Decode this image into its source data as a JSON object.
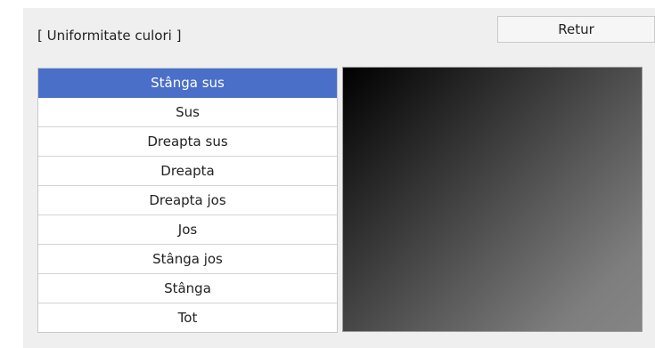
{
  "header": {
    "title": "[ Uniformitate culori ]",
    "return_label": "Retur"
  },
  "menu": {
    "selected_index": 0,
    "items": [
      {
        "label": "Stânga sus"
      },
      {
        "label": "Sus"
      },
      {
        "label": "Dreapta sus"
      },
      {
        "label": "Dreapta"
      },
      {
        "label": "Dreapta jos"
      },
      {
        "label": "Jos"
      },
      {
        "label": "Stânga jos"
      },
      {
        "label": "Stânga"
      },
      {
        "label": "Tot"
      }
    ]
  },
  "colors": {
    "panel_background": "#efefef",
    "selection_accent": "#4a6fc9",
    "preview_gradient": [
      "#000000",
      "#858585"
    ]
  }
}
